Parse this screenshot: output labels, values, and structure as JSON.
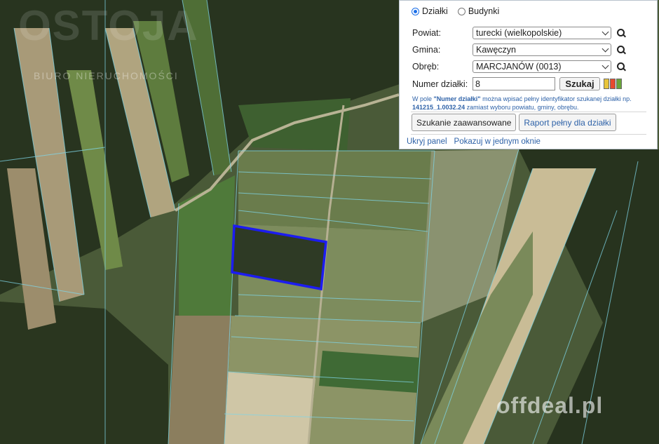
{
  "panel": {
    "radios": [
      {
        "label": "Działki",
        "selected": true
      },
      {
        "label": "Budynki",
        "selected": false
      }
    ],
    "powiat": {
      "label": "Powiat:",
      "value": "turecki (wielkopolskie)"
    },
    "gmina": {
      "label": "Gmina:",
      "value": "Kawęczyn"
    },
    "obreb": {
      "label": "Obręb:",
      "value": "MARCJANÓW (0013)"
    },
    "numer": {
      "label": "Numer działki:",
      "value": "8"
    },
    "search_label": "Szukaj",
    "hint": {
      "p1": "W pole ",
      "strong1": "\"Numer działki\"",
      "p2": " można wpisać pełny identyfikator szukanej działki np. ",
      "strong2": "141215_1.0032.24",
      "p3": " zamiast wyboru powiatu, gminy, obrębu."
    },
    "advanced_label": "Szukanie zaawansowane",
    "report_label": "Raport pełny dla działki",
    "hide_link": "Ukryj panel",
    "window_link": "Pokazuj w jednym oknie",
    "colors": [
      "#e8c43a",
      "#e84a2f",
      "#6aa53a"
    ]
  },
  "watermarks": {
    "top_logo": "OSTOJA",
    "top_sub": "BIURO NIERUCHOMOŚCI",
    "bottom": "offdeal.pl"
  },
  "map": {
    "highlight_color": "#1c1cf0",
    "parcel_line_color": "#7fd6e8"
  }
}
